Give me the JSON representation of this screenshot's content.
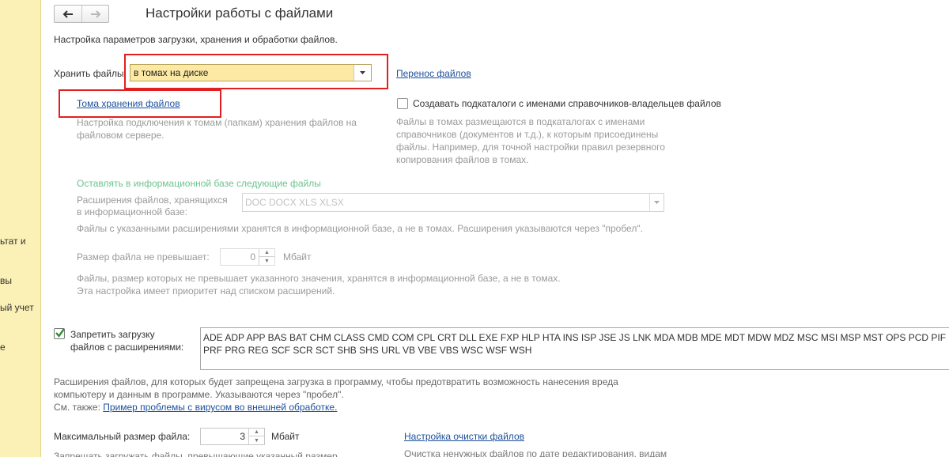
{
  "sidebar": {
    "items": [
      "ьтат и",
      "вы",
      "ый учет",
      "е"
    ]
  },
  "nav": {
    "back_icon": "arrow-left-icon",
    "forward_icon": "arrow-right-icon"
  },
  "header": {
    "title": "Настройки работы с файлами"
  },
  "description": "Настройка параметров загрузки, хранения и обработки файлов.",
  "storage": {
    "label": "Хранить файлы:",
    "value": "в томах на диске",
    "transfer_link": "Перенос файлов",
    "volumes_link": "Тома хранения файлов",
    "volumes_hint_1": "Настройка подключения к томам (папкам) хранения файлов на",
    "volumes_hint_2": "файловом сервере.",
    "subdirs_label": "Создавать подкаталоги с именами справочников-владельцев файлов",
    "subdirs_checked": false,
    "subdirs_hint_1": "Файлы в томах размещаются в подкаталогах с именами",
    "subdirs_hint_2": "справочников (документов и т.д.), к которым присоединены",
    "subdirs_hint_3": "файлы. Например, для точной настройки правил резервного",
    "subdirs_hint_4": "копирования файлов в томах."
  },
  "infobase": {
    "group_title": "Оставлять в информационной базе следующие файлы",
    "ext_label_1": "Расширения файлов, хранящихся",
    "ext_label_2": "в информационной базе:",
    "ext_value": "DOC DOCX XLS XLSX",
    "ext_hint": "Файлы с указанными расширениями хранятся в информационной базе, а не в томах. Расширения указываются через \"пробел\".",
    "size_label": "Размер файла не превышает:",
    "size_value": "0",
    "size_unit": "Мбайт",
    "size_hint_1": "Файлы, размер которых не превышает указанного значения, хранятся в информационной базе, а не в томах.",
    "size_hint_2": "Эта настройка имеет приоритет над списком расширений."
  },
  "forbid": {
    "label_1": "Запретить загрузку",
    "label_2": "файлов с расширениями:",
    "checked": true,
    "extensions": "ADE ADP APP BAS BAT CHM CLASS CMD COM CPL CRT DLL EXE FXP HLP HTA INS ISP JSE JS LNK MDA MDB MDE MDT MDW MDZ MSC MSI MSP MST OPS PCD PIF PRF PRG REG SCF SCR SCT SHB SHS URL VB VBE VBS WSC WSF WSH",
    "hint_1": "Расширения файлов, для которых будет запрещена загрузка в программу, чтобы предотвратить возможность нанесения вреда",
    "hint_2": "компьютеру и данным в программе. Указываются через \"пробел\".",
    "see_also": "См. также:",
    "see_also_link": "Пример проблемы с вирусом во внешней  обработке."
  },
  "maxsize": {
    "label": "Максимальный размер файла:",
    "value": "3",
    "unit": "Мбайт",
    "hint": "Запрещать загружать файлы, превышающие указанный размер",
    "cleanup_link": "Настройка очистки файлов",
    "cleanup_hint": "Очистка ненужных файлов по дате редактирования, видам"
  },
  "colors": {
    "sidebar": "#fbf1b6",
    "link": "#1b4f9b",
    "highlight_red": "#e21f1f",
    "group_title_green": "#6cc38e",
    "select_bg": "#fde9a4"
  }
}
